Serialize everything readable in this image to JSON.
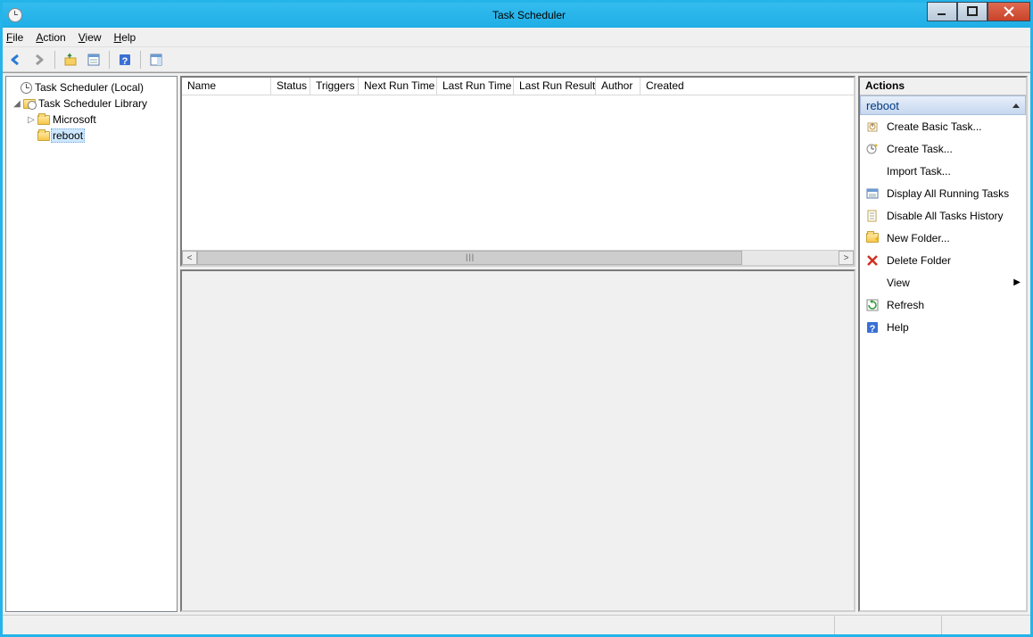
{
  "window": {
    "title": "Task Scheduler"
  },
  "menu": {
    "file": "File",
    "action": "Action",
    "view": "View",
    "help": "Help"
  },
  "tree": {
    "root": "Task Scheduler (Local)",
    "library": "Task Scheduler Library",
    "microsoft": "Microsoft",
    "reboot": "reboot"
  },
  "columns": {
    "name": "Name",
    "status": "Status",
    "triggers": "Triggers",
    "nextrun": "Next Run Time",
    "lastrun": "Last Run Time",
    "lastresult": "Last Run Result",
    "author": "Author",
    "created": "Created"
  },
  "actions": {
    "header": "Actions",
    "context": "reboot",
    "items": {
      "createBasic": "Create Basic Task...",
      "createTask": "Create Task...",
      "importTask": "Import Task...",
      "displayRunning": "Display All Running Tasks",
      "disableHistory": "Disable All Tasks History",
      "newFolder": "New Folder...",
      "deleteFolder": "Delete Folder",
      "view": "View",
      "refresh": "Refresh",
      "help": "Help"
    }
  }
}
